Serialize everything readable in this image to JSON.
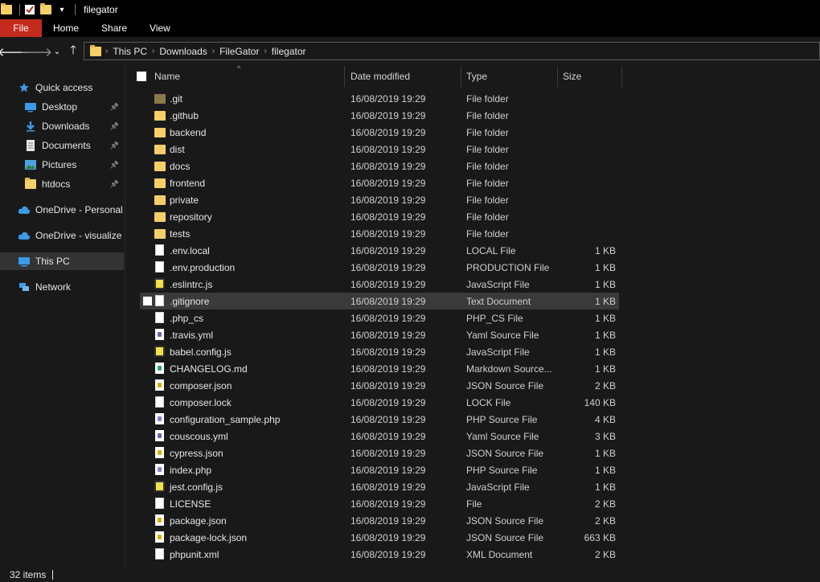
{
  "window": {
    "title": "filegator"
  },
  "ribbon": {
    "tabs": [
      "File",
      "Home",
      "Share",
      "View"
    ]
  },
  "address": {
    "crumbs": [
      "This PC",
      "Downloads",
      "FileGator",
      "filegator"
    ]
  },
  "sidebar": {
    "items": [
      {
        "label": "Quick access",
        "icon": "star-icon",
        "pinned": false,
        "indent": 1
      },
      {
        "label": "Desktop",
        "icon": "desktop-icon",
        "pinned": true,
        "indent": 2
      },
      {
        "label": "Downloads",
        "icon": "download-icon",
        "pinned": true,
        "indent": 2
      },
      {
        "label": "Documents",
        "icon": "documents-icon",
        "pinned": true,
        "indent": 2
      },
      {
        "label": "Pictures",
        "icon": "pictures-icon",
        "pinned": true,
        "indent": 2
      },
      {
        "label": "htdocs",
        "icon": "folder-icon",
        "pinned": true,
        "indent": 2
      },
      {
        "label": "OneDrive - Personal",
        "icon": "cloud-icon",
        "pinned": false,
        "indent": 1
      },
      {
        "label": "OneDrive - visualize E",
        "icon": "cloud-icon",
        "pinned": false,
        "indent": 1
      },
      {
        "label": "This PC",
        "icon": "computer-icon",
        "pinned": false,
        "indent": 1,
        "selected": true
      },
      {
        "label": "Network",
        "icon": "network-icon",
        "pinned": false,
        "indent": 1
      }
    ]
  },
  "columns": {
    "name": "Name",
    "date": "Date modified",
    "type": "Type",
    "size": "Size"
  },
  "files": [
    {
      "name": ".git",
      "date": "16/08/2019 19:29",
      "type": "File folder",
      "size": "",
      "icon": "folder-git"
    },
    {
      "name": ".github",
      "date": "16/08/2019 19:29",
      "type": "File folder",
      "size": "",
      "icon": "folder"
    },
    {
      "name": "backend",
      "date": "16/08/2019 19:29",
      "type": "File folder",
      "size": "",
      "icon": "folder"
    },
    {
      "name": "dist",
      "date": "16/08/2019 19:29",
      "type": "File folder",
      "size": "",
      "icon": "folder"
    },
    {
      "name": "docs",
      "date": "16/08/2019 19:29",
      "type": "File folder",
      "size": "",
      "icon": "folder"
    },
    {
      "name": "frontend",
      "date": "16/08/2019 19:29",
      "type": "File folder",
      "size": "",
      "icon": "folder"
    },
    {
      "name": "private",
      "date": "16/08/2019 19:29",
      "type": "File folder",
      "size": "",
      "icon": "folder"
    },
    {
      "name": "repository",
      "date": "16/08/2019 19:29",
      "type": "File folder",
      "size": "",
      "icon": "folder"
    },
    {
      "name": "tests",
      "date": "16/08/2019 19:29",
      "type": "File folder",
      "size": "",
      "icon": "folder"
    },
    {
      "name": ".env.local",
      "date": "16/08/2019 19:29",
      "type": "LOCAL File",
      "size": "1 KB",
      "icon": "file"
    },
    {
      "name": ".env.production",
      "date": "16/08/2019 19:29",
      "type": "PRODUCTION File",
      "size": "1 KB",
      "icon": "file"
    },
    {
      "name": ".eslintrc.js",
      "date": "16/08/2019 19:29",
      "type": "JavaScript File",
      "size": "1 KB",
      "icon": "js"
    },
    {
      "name": ".gitignore",
      "date": "16/08/2019 19:29",
      "type": "Text Document",
      "size": "1 KB",
      "icon": "file",
      "hover": true
    },
    {
      "name": ".php_cs",
      "date": "16/08/2019 19:29",
      "type": "PHP_CS File",
      "size": "1 KB",
      "icon": "file"
    },
    {
      "name": ".travis.yml",
      "date": "16/08/2019 19:29",
      "type": "Yaml Source File",
      "size": "1 KB",
      "icon": "yaml"
    },
    {
      "name": "babel.config.js",
      "date": "16/08/2019 19:29",
      "type": "JavaScript File",
      "size": "1 KB",
      "icon": "js"
    },
    {
      "name": "CHANGELOG.md",
      "date": "16/08/2019 19:29",
      "type": "Markdown Source...",
      "size": "1 KB",
      "icon": "md"
    },
    {
      "name": "composer.json",
      "date": "16/08/2019 19:29",
      "type": "JSON Source File",
      "size": "2 KB",
      "icon": "json"
    },
    {
      "name": "composer.lock",
      "date": "16/08/2019 19:29",
      "type": "LOCK File",
      "size": "140 KB",
      "icon": "file"
    },
    {
      "name": "configuration_sample.php",
      "date": "16/08/2019 19:29",
      "type": "PHP Source File",
      "size": "4 KB",
      "icon": "php"
    },
    {
      "name": "couscous.yml",
      "date": "16/08/2019 19:29",
      "type": "Yaml Source File",
      "size": "3 KB",
      "icon": "yaml"
    },
    {
      "name": "cypress.json",
      "date": "16/08/2019 19:29",
      "type": "JSON Source File",
      "size": "1 KB",
      "icon": "json"
    },
    {
      "name": "index.php",
      "date": "16/08/2019 19:29",
      "type": "PHP Source File",
      "size": "1 KB",
      "icon": "php"
    },
    {
      "name": "jest.config.js",
      "date": "16/08/2019 19:29",
      "type": "JavaScript File",
      "size": "1 KB",
      "icon": "js"
    },
    {
      "name": "LICENSE",
      "date": "16/08/2019 19:29",
      "type": "File",
      "size": "2 KB",
      "icon": "file"
    },
    {
      "name": "package.json",
      "date": "16/08/2019 19:29",
      "type": "JSON Source File",
      "size": "2 KB",
      "icon": "json"
    },
    {
      "name": "package-lock.json",
      "date": "16/08/2019 19:29",
      "type": "JSON Source File",
      "size": "663 KB",
      "icon": "json"
    },
    {
      "name": "phpunit.xml",
      "date": "16/08/2019 19:29",
      "type": "XML Document",
      "size": "2 KB",
      "icon": "file"
    }
  ],
  "status": {
    "count": "32 items"
  },
  "colors": {
    "accent_file_tab": "#c42b1c",
    "folder": "#f5cf67",
    "background": "#191919"
  }
}
